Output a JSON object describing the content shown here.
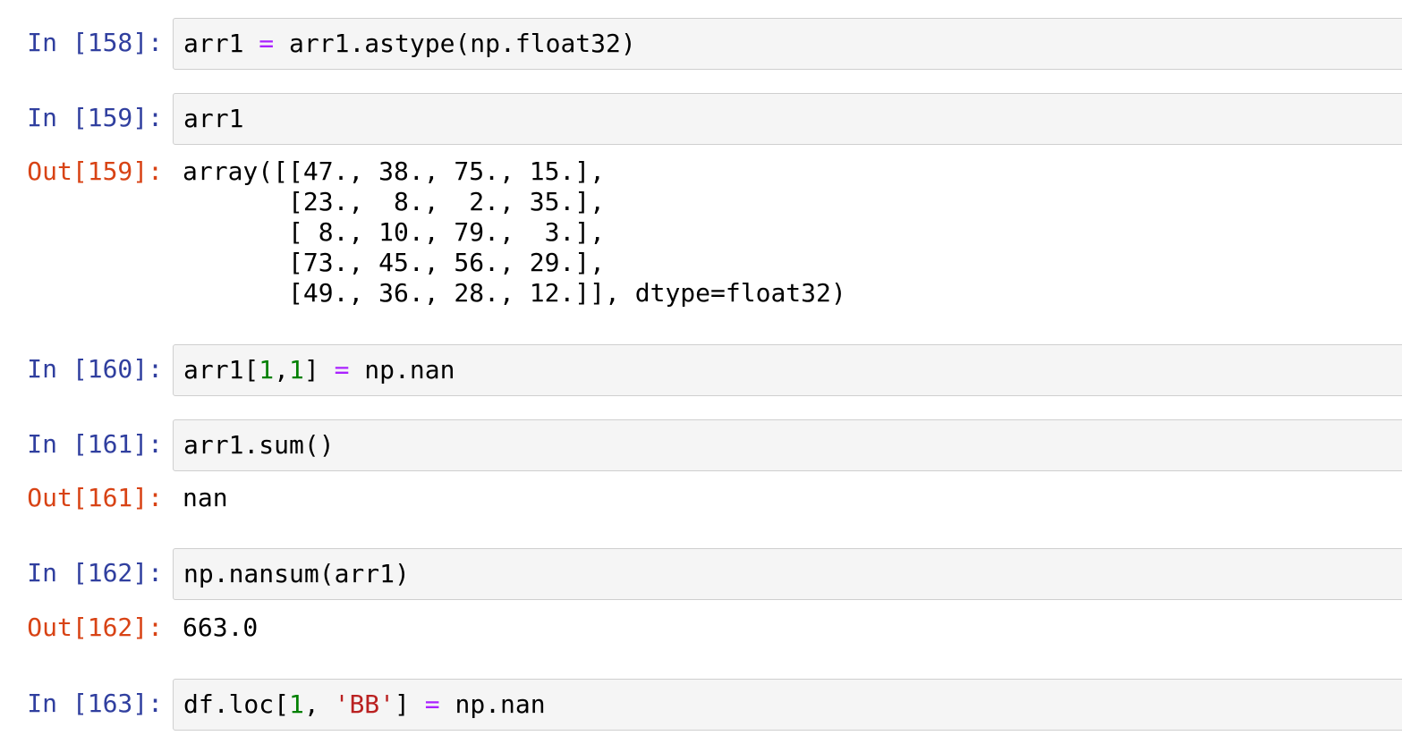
{
  "cells": [
    {
      "in_prompt": "In [158]:",
      "code": [
        "arr1 ",
        "=",
        " arr1.astype(np.float32)"
      ]
    },
    {
      "in_prompt": "In [159]:",
      "code": [
        "arr1"
      ],
      "out_prompt": "Out[159]:",
      "output": [
        "array([[47., 38., 75., 15.],",
        "       [23.,  8.,  2., 35.],",
        "       [ 8., 10., 79.,  3.],",
        "       [73., 45., 56., 29.],",
        "       [49., 36., 28., 12.]], dtype=float32)"
      ]
    },
    {
      "in_prompt": "In [160]:",
      "code": [
        "arr1[",
        "1",
        ",",
        "1",
        "] ",
        "=",
        " np.nan"
      ]
    },
    {
      "in_prompt": "In [161]:",
      "code": [
        "arr1.sum()"
      ],
      "out_prompt": "Out[161]:",
      "output": [
        "nan"
      ]
    },
    {
      "in_prompt": "In [162]:",
      "code": [
        "np.nansum(arr1)"
      ],
      "out_prompt": "Out[162]:",
      "output": [
        "663.0"
      ]
    },
    {
      "in_prompt": "In [163]:",
      "code": [
        "df.loc[",
        "1",
        ", ",
        "'BB'",
        "] ",
        "=",
        " np.nan"
      ]
    }
  ],
  "colors": {
    "in_prompt": "#303f9f",
    "out_prompt": "#d84315",
    "operator": "#aa22ff",
    "number": "#008000",
    "string": "#ba2121",
    "cell_background": "#f5f5f5",
    "cell_border": "#cfcfcf"
  }
}
